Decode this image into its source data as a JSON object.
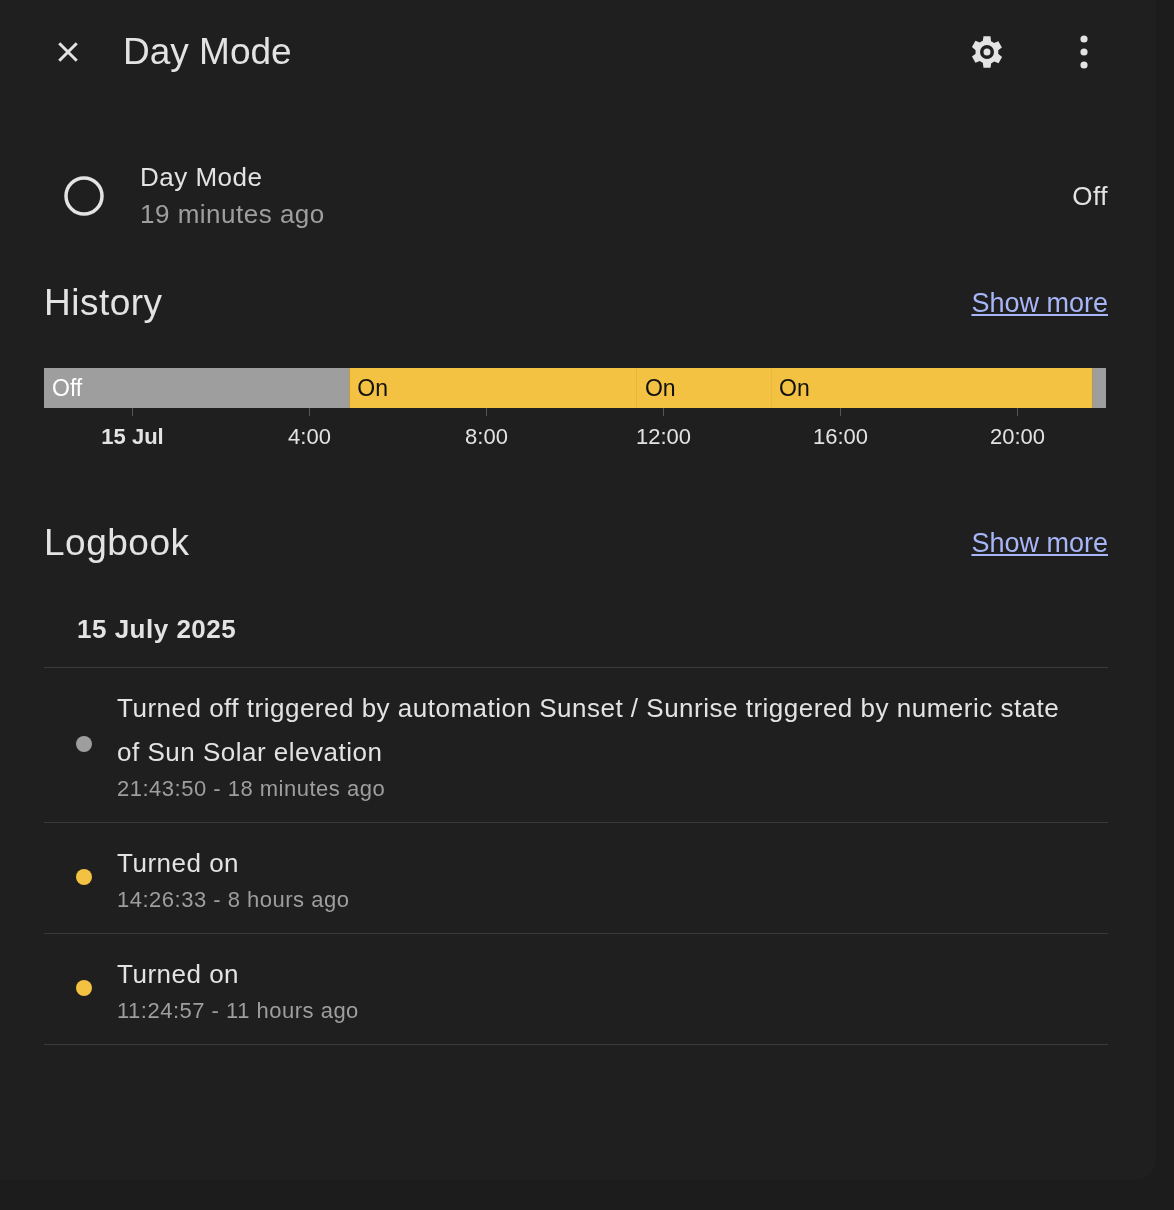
{
  "header": {
    "title": "Day Mode"
  },
  "entity": {
    "name": "Day Mode",
    "last_changed": "19 minutes ago",
    "state": "Off",
    "on": false
  },
  "history": {
    "title": "History",
    "show_more": "Show more",
    "timeline": [
      {
        "label": "Off",
        "kind": "off"
      },
      {
        "label": "On",
        "kind": "on"
      },
      {
        "label": "On",
        "kind": "on"
      },
      {
        "label": "On",
        "kind": "on"
      },
      {
        "kind": "off"
      }
    ],
    "axis_labels": [
      "15 Jul",
      "4:00",
      "8:00",
      "12:00",
      "16:00",
      "20:00"
    ]
  },
  "logbook": {
    "title": "Logbook",
    "show_more": "Show more",
    "date": "15 July 2025",
    "entries": [
      {
        "message": "Turned off triggered by automation Sunset / Sunrise triggered by numeric state of Sun Solar elevation",
        "time": "21:43:50 - 18 minutes ago",
        "color": "#9e9e9e"
      },
      {
        "message": "Turned on",
        "time": "14:26:33 - 8 hours ago",
        "color": "#f4c242"
      },
      {
        "message": "Turned on",
        "time": "11:24:57 - 11 hours ago",
        "color": "#f4c242"
      }
    ]
  }
}
